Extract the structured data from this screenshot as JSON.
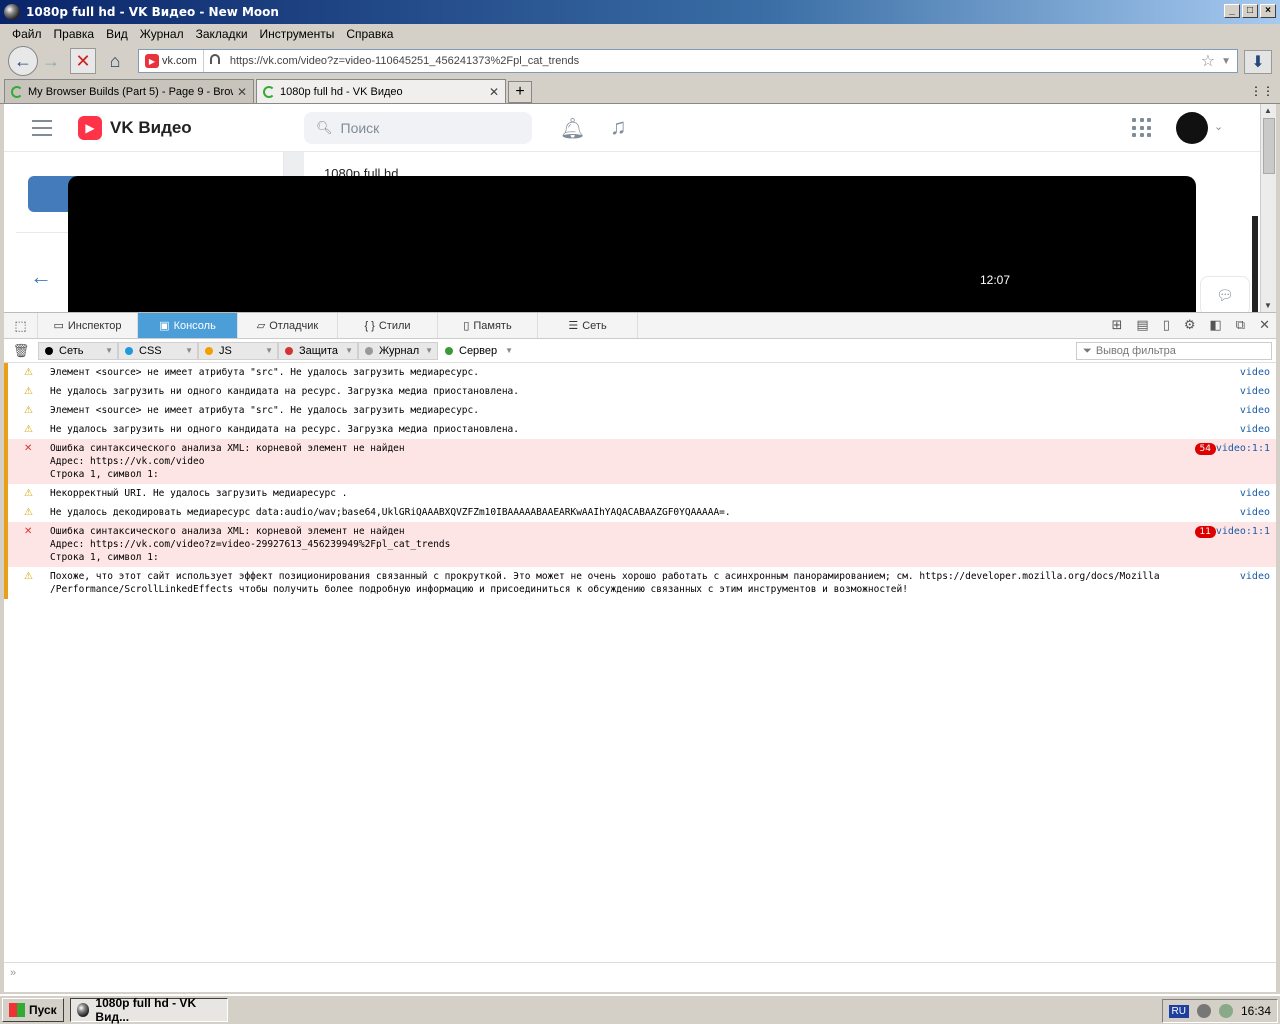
{
  "window": {
    "title": "1080p full hd - VK Видео - New Moon"
  },
  "menu": [
    "Файл",
    "Правка",
    "Вид",
    "Журнал",
    "Закладки",
    "Инструменты",
    "Справка"
  ],
  "nav": {
    "site": "vk.com",
    "url": "https://vk.com/video?z=video-110645251_456241373%2Fpl_cat_trends"
  },
  "tabs": [
    {
      "label": "My Browser Builds (Part 5) - Page 9 - Brow"
    },
    {
      "label": "1080p full hd - VK Видео"
    }
  ],
  "page": {
    "brand": "VK Видео",
    "search_placeholder": "Поиск",
    "video_title": "1080p full hd",
    "video_time": "12:07"
  },
  "devtools": {
    "tabs": [
      "Инспектор",
      "Консоль",
      "Отладчик",
      "Стили",
      "Память",
      "Сеть"
    ],
    "filters": [
      "Сеть",
      "CSS",
      "JS",
      "Защита",
      "Журнал",
      "Сервер"
    ],
    "filter_colors": [
      "#000000",
      "#1e9bdc",
      "#f0a000",
      "#d33333",
      "#999999",
      "#3a9a3a"
    ],
    "filter_placeholder": "Вывод фильтра",
    "messages": [
      {
        "level": "warn",
        "text": "Элемент <source> не имеет атрибута \"src\". Не удалось загрузить медиаресурс.",
        "src": "video"
      },
      {
        "level": "warn",
        "text": "Не удалось загрузить ни одного кандидата на ресурс. Загрузка медиа приостановлена.",
        "src": "video"
      },
      {
        "level": "warn",
        "text": "Элемент <source> не имеет атрибута \"src\". Не удалось загрузить медиаресурс.",
        "src": "video"
      },
      {
        "level": "warn",
        "text": "Не удалось загрузить ни одного кандидата на ресурс. Загрузка медиа приостановлена.",
        "src": "video"
      },
      {
        "level": "error",
        "text": "Ошибка синтаксического анализа XML: корневой элемент не найден\nАдрес: https://vk.com/video\nСтрока 1, символ 1:",
        "src": "video:1:1",
        "count": "54"
      },
      {
        "level": "warn",
        "text": "Некорректный URI. Не удалось загрузить медиаресурс .",
        "src": "video"
      },
      {
        "level": "warn",
        "text": "Не удалось декодировать медиаресурс data:audio/wav;base64,UklGRiQAAABXQVZFZm10IBAAAAABAAEARKwAAIhYAQACABAAZGF0YQAAAAA=.",
        "src": "video"
      },
      {
        "level": "error",
        "text": "Ошибка синтаксического анализа XML: корневой элемент не найден\nАдрес: https://vk.com/video?z=video-29927613_456239949%2Fpl_cat_trends\nСтрока 1, символ 1:",
        "src": "video:1:1",
        "count": "11"
      },
      {
        "level": "warn",
        "text": "Похоже, что этот сайт использует эффект позиционирования связанный с прокруткой. Это может не очень хорошо работать с асинхронным панорамированием; см. https://developer.mozilla.org/docs/Mozilla\n/Performance/ScrollLinkedEffects чтобы получить более подробную информацию и присоединиться к обсуждению связанных с этим инструментов и возможностей!",
        "src": "video"
      }
    ]
  },
  "taskbar": {
    "start": "Пуск",
    "task": "1080p full hd - VK Вид...",
    "lang": "RU",
    "clock": "16:34"
  }
}
